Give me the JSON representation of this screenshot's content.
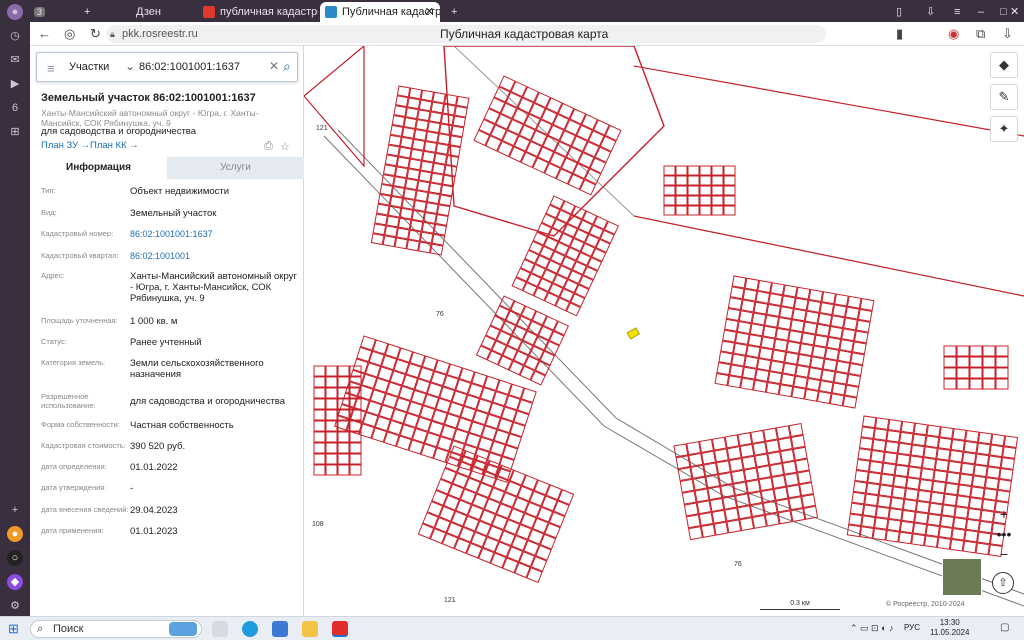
{
  "browser": {
    "tab_count": "3",
    "tabs": [
      {
        "title": "Дзен"
      },
      {
        "title": "публичная кадастровая"
      },
      {
        "title": "Публичная кадастровая"
      }
    ],
    "url": "pkk.rosreestr.ru",
    "page_title": "Публичная кадастровая карта"
  },
  "search": {
    "type": "Участки",
    "query": "86:02:1001001:1637"
  },
  "object": {
    "title": "Земельный участок 86:02:1001001:1637",
    "address": "Ханты-Мансийский автономный округ - Югра, г. Ханты-Мансийск, СОК Рябинушка, уч. 9",
    "usage": "для садоводства и огородничества",
    "plan_zu": "План ЗУ →",
    "plan_kk": "План КК →"
  },
  "panel_tabs": {
    "info": "Информация",
    "services": "Услуги"
  },
  "properties": [
    {
      "key": "Тип:",
      "value": "Объект недвижимости"
    },
    {
      "key": "Вид:",
      "value": "Земельный участок"
    },
    {
      "key": "Кадастровый номер:",
      "value": "86:02:1001001:1637"
    },
    {
      "key": "Кадастровый квартал:",
      "value": "86:02:1001001"
    },
    {
      "key": "Адрес:",
      "value": "Ханты-Мансийский автономный округ - Югра, г. Ханты-Мансийск, СОК Рябинушка, уч. 9"
    },
    {
      "key": "Площадь уточненная:",
      "value": "1 000 кв. м"
    },
    {
      "key": "Статус:",
      "value": "Ранее учтенный"
    },
    {
      "key": "Категория земель:",
      "value": "Земли сельскохозяйственного назначения"
    },
    {
      "key": "Разрешенное использование:",
      "value": "для садоводства и огородничества"
    },
    {
      "key": "Форма собственности:",
      "value": "Частная собственность"
    },
    {
      "key": "Кадастровая стоимость:",
      "value": "390 520 руб."
    },
    {
      "key": "дата определения:",
      "value": "01.01.2022"
    },
    {
      "key": "дата утверждения:",
      "value": "-"
    },
    {
      "key": "дата внесения сведений:",
      "value": "29.04.2023"
    },
    {
      "key": "дата применения:",
      "value": "01.01.2023"
    }
  ],
  "map": {
    "labels": [
      "121",
      "76",
      "76",
      "108",
      "121"
    ],
    "scale": "0.3 км",
    "copyright": "© Росреестр, 2010-2024",
    "colors": {
      "parcel": "#c8202a",
      "selected": "#f2e600",
      "road": "#555555"
    }
  },
  "taskbar": {
    "search_placeholder": "Поиск",
    "lang": "РУС",
    "time": "13:30",
    "date": "11.05.2024"
  }
}
